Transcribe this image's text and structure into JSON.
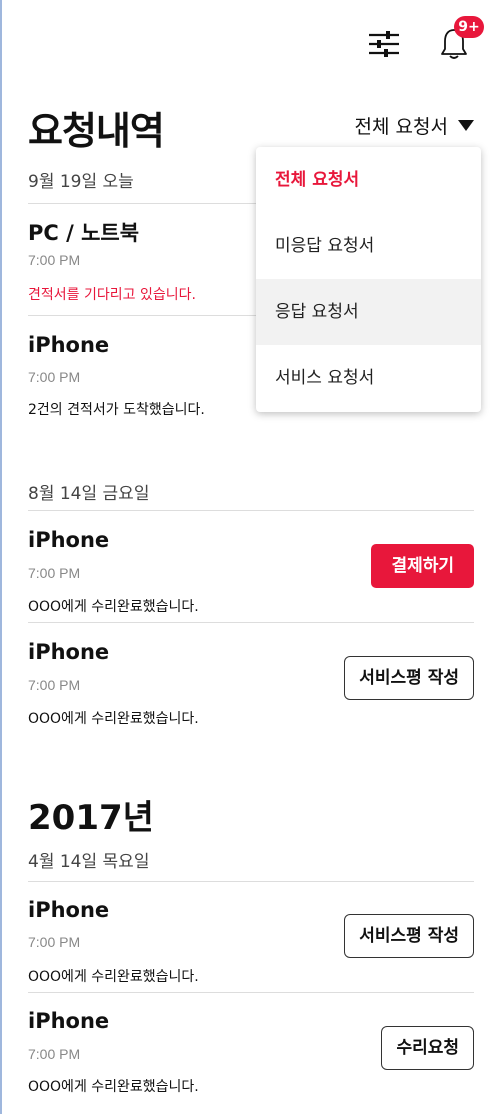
{
  "header": {
    "filter_icon": "sliders-icon",
    "bell_icon": "bell-icon",
    "notification_badge": "9+"
  },
  "page_title": "요청내역",
  "filter": {
    "selected": "전체 요청서"
  },
  "dropdown": {
    "items": [
      {
        "label": "전체 요청서",
        "active": true
      },
      {
        "label": "미응답 요청서"
      },
      {
        "label": "응답 요청서",
        "hovered": true
      },
      {
        "label": "서비스 요청서"
      }
    ]
  },
  "sections": [
    {
      "date": "9월 19일 오늘",
      "items": [
        {
          "title": "PC / 노트북",
          "time": "7:00 PM",
          "status": "견적서를 기다리고 있습니다.",
          "status_color": "#e8173b"
        },
        {
          "title": "iPhone",
          "time": "7:00 PM",
          "status": "2건의 견적서가 도착했습니다."
        }
      ]
    },
    {
      "date": "8월 14일 금요일",
      "items": [
        {
          "title": "iPhone",
          "time": "7:00 PM",
          "status": "OOO에게 수리완료했습니다.",
          "button": "결제하기"
        },
        {
          "title": "iPhone",
          "time": "7:00 PM",
          "status": "OOO에게 수리완료했습니다.",
          "button": "서비스평 작성"
        }
      ]
    },
    {
      "year": "2017년",
      "date": "4월 14일 목요일",
      "items": [
        {
          "title": "iPhone",
          "time": "7:00 PM",
          "status": "OOO에게 수리완료했습니다.",
          "button": "서비스평 작성"
        },
        {
          "title": "iPhone",
          "time": "7:00 PM",
          "status": "OOO에게 수리완료했습니다.",
          "button": "수리요청"
        }
      ]
    }
  ],
  "colors": {
    "accent": "#e8173b",
    "divider": "#dddddd"
  }
}
